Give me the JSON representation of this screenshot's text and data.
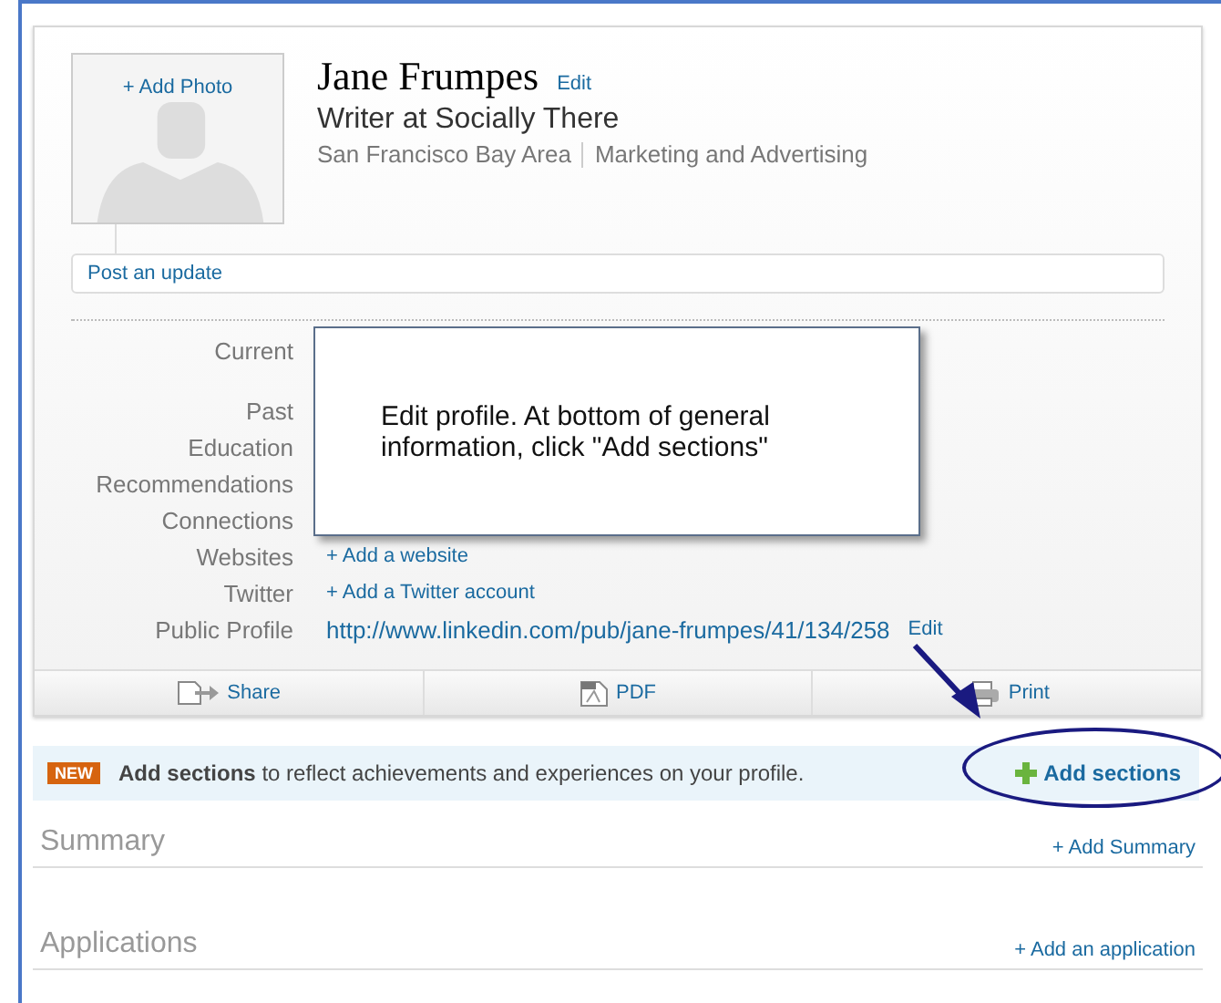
{
  "profile": {
    "add_photo": "+ Add Photo",
    "name": "Jane Frumpes",
    "edit": "Edit",
    "headline": "Writer at Socially There",
    "location": "San Francisco Bay Area",
    "industry": "Marketing and Advertising"
  },
  "update": {
    "placeholder": "Post an update"
  },
  "rows": [
    {
      "label": "Current"
    },
    {
      "label": "Past"
    },
    {
      "label": "Education"
    },
    {
      "label": "Recommendations"
    },
    {
      "label": "Connections"
    },
    {
      "label": "Websites",
      "value": "+ Add a website"
    },
    {
      "label": "Twitter",
      "value": "+ Add a Twitter account"
    },
    {
      "label": "Public Profile",
      "value": "http://www.linkedin.com/pub/jane-frumpes/41/134/258",
      "edit": "Edit"
    }
  ],
  "callout": {
    "text": "Edit profile. At bottom of general information, click \"Add sections\""
  },
  "actions": [
    {
      "kind": "share",
      "label": "Share"
    },
    {
      "kind": "pdf",
      "label": "PDF"
    },
    {
      "kind": "print",
      "label": "Print"
    }
  ],
  "banner": {
    "badge": "NEW",
    "text": "**Add sections** to reflect achievements and experiences on your profile.",
    "button": "Add sections"
  },
  "sections": [
    {
      "title": "Summary",
      "link": "+ Add Summary"
    },
    {
      "title": "Applications",
      "link": "+ Add an application"
    }
  ]
}
